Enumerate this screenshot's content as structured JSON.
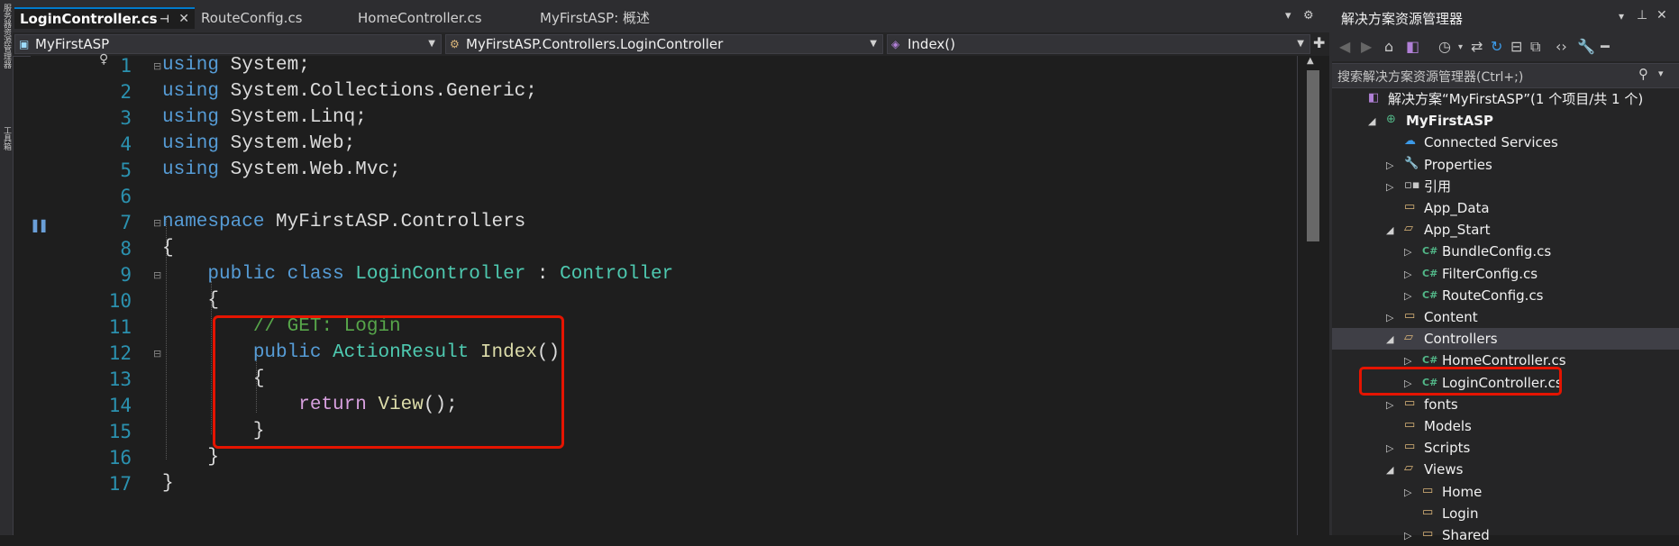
{
  "left_strip": {
    "labels": [
      "服务器资源管理器",
      "工具箱"
    ]
  },
  "tabs": [
    {
      "label": "LoginController.cs",
      "active": true
    },
    {
      "label": "RouteConfig.cs",
      "active": false
    },
    {
      "label": "HomeController.cs",
      "active": false
    },
    {
      "label": "MyFirstASP: 概述",
      "active": false
    }
  ],
  "nav": {
    "project": "MyFirstASP",
    "class": "MyFirstASP.Controllers.LoginController",
    "member": "Index()"
  },
  "editor": {
    "line_numbers": [
      "1",
      "2",
      "3",
      "4",
      "5",
      "6",
      "7",
      "8",
      "9",
      "10",
      "11",
      "12",
      "13",
      "14",
      "15",
      "16",
      "17"
    ],
    "lines": [
      [
        [
          "kw",
          "using"
        ],
        [
          "pl",
          " System;"
        ]
      ],
      [
        [
          "kw",
          "using"
        ],
        [
          "pl",
          " System.Collections.Generic;"
        ]
      ],
      [
        [
          "kw",
          "using"
        ],
        [
          "pl",
          " System.Linq;"
        ]
      ],
      [
        [
          "kw",
          "using"
        ],
        [
          "pl",
          " System.Web;"
        ]
      ],
      [
        [
          "kw",
          "using"
        ],
        [
          "pl",
          " System.Web.Mvc;"
        ]
      ],
      [],
      [
        [
          "kw",
          "namespace"
        ],
        [
          "pl",
          " MyFirstASP.Controllers"
        ]
      ],
      [
        [
          "pl",
          "{"
        ]
      ],
      [
        [
          "pl",
          "    "
        ],
        [
          "kw",
          "public"
        ],
        [
          "pl",
          " "
        ],
        [
          "kw",
          "class"
        ],
        [
          "pl",
          " "
        ],
        [
          "ty",
          "LoginController"
        ],
        [
          "pl",
          " : "
        ],
        [
          "ty",
          "Controller"
        ]
      ],
      [
        [
          "pl",
          "    {"
        ]
      ],
      [
        [
          "pl",
          "        "
        ],
        [
          "cm",
          "// GET: Login"
        ]
      ],
      [
        [
          "pl",
          "        "
        ],
        [
          "kw",
          "public"
        ],
        [
          "pl",
          " "
        ],
        [
          "ty",
          "ActionResult"
        ],
        [
          "pl",
          " "
        ],
        [
          "fn",
          "Index"
        ],
        [
          "pl",
          "()"
        ]
      ],
      [
        [
          "pl",
          "        {"
        ]
      ],
      [
        [
          "pl",
          "            "
        ],
        [
          "kw2",
          "return"
        ],
        [
          "pl",
          " "
        ],
        [
          "fn",
          "View"
        ],
        [
          "pl",
          "();"
        ]
      ],
      [
        [
          "pl",
          "        }"
        ]
      ],
      [
        [
          "pl",
          "    }"
        ]
      ],
      [
        [
          "pl",
          "}"
        ]
      ]
    ]
  },
  "solution_explorer": {
    "title": "解决方案资源管理器",
    "search_placeholder": "搜索解决方案资源管理器(Ctrl+;)",
    "nodes": [
      {
        "label": "解决方案“MyFirstASP”(1 个项目/共 1 个)",
        "icon": "solution-icon",
        "depth": 0,
        "expander": ""
      },
      {
        "label": "MyFirstASP",
        "icon": "web-project-icon",
        "depth": 1,
        "expander": "expanded",
        "bold": true
      },
      {
        "label": "Connected Services",
        "icon": "connected-services-icon",
        "depth": 2,
        "expander": ""
      },
      {
        "label": "Properties",
        "icon": "wrench-icon",
        "depth": 2,
        "expander": "collapsed"
      },
      {
        "label": "引用",
        "icon": "references-icon",
        "depth": 2,
        "expander": "collapsed"
      },
      {
        "label": "App_Data",
        "icon": "folder-icon",
        "depth": 2,
        "expander": ""
      },
      {
        "label": "App_Start",
        "icon": "folder-open-icon",
        "depth": 2,
        "expander": "expanded"
      },
      {
        "label": "BundleConfig.cs",
        "icon": "csharp-file-icon",
        "depth": 3,
        "expander": "collapsed"
      },
      {
        "label": "FilterConfig.cs",
        "icon": "csharp-file-icon",
        "depth": 3,
        "expander": "collapsed"
      },
      {
        "label": "RouteConfig.cs",
        "icon": "csharp-file-icon",
        "depth": 3,
        "expander": "collapsed"
      },
      {
        "label": "Content",
        "icon": "folder-icon",
        "depth": 2,
        "expander": "collapsed"
      },
      {
        "label": "Controllers",
        "icon": "folder-open-icon",
        "depth": 2,
        "expander": "expanded",
        "selected": true
      },
      {
        "label": "HomeController.cs",
        "icon": "csharp-file-icon",
        "depth": 3,
        "expander": "collapsed"
      },
      {
        "label": "LoginController.cs",
        "icon": "csharp-file-icon",
        "depth": 3,
        "expander": "collapsed"
      },
      {
        "label": "fonts",
        "icon": "folder-icon",
        "depth": 2,
        "expander": "collapsed"
      },
      {
        "label": "Models",
        "icon": "folder-icon",
        "depth": 2,
        "expander": ""
      },
      {
        "label": "Scripts",
        "icon": "folder-icon",
        "depth": 2,
        "expander": "collapsed"
      },
      {
        "label": "Views",
        "icon": "folder-open-icon",
        "depth": 2,
        "expander": "expanded"
      },
      {
        "label": "Home",
        "icon": "folder-icon",
        "depth": 3,
        "expander": "collapsed"
      },
      {
        "label": "Login",
        "icon": "folder-icon",
        "depth": 3,
        "expander": ""
      },
      {
        "label": "Shared",
        "icon": "folder-icon",
        "depth": 3,
        "expander": "collapsed"
      }
    ]
  },
  "colors": {
    "accent": "#007acc",
    "highlight": "#e51400",
    "keyword": "#569cd6",
    "type": "#4ec9b0",
    "comment": "#57a64a"
  }
}
